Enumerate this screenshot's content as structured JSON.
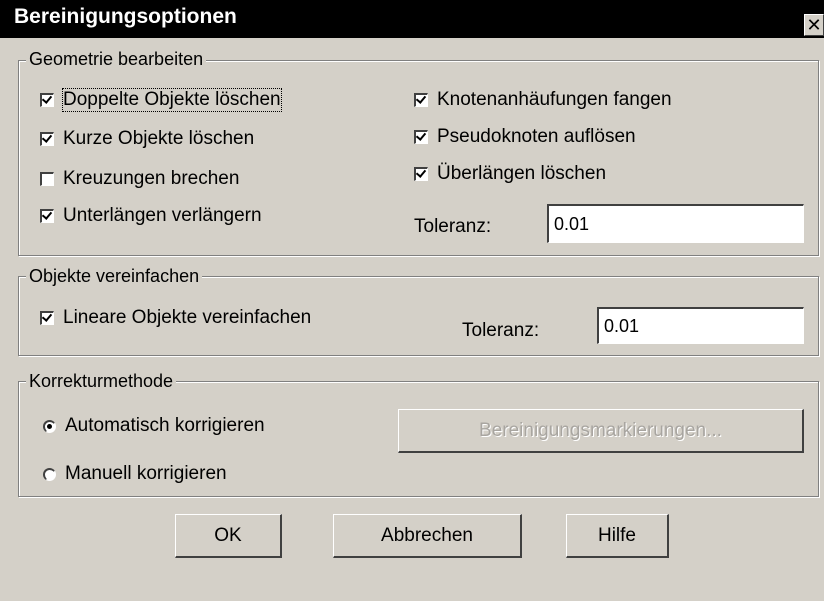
{
  "title": "Bereinigungsoptionen",
  "close_glyph": "✕",
  "geometry": {
    "legend": "Geometrie bearbeiten",
    "left_options": [
      {
        "label": "Doppelte Objekte löschen",
        "checked": true
      },
      {
        "label": "Kurze Objekte löschen",
        "checked": true
      },
      {
        "label": "Kreuzungen brechen",
        "checked": false
      },
      {
        "label": "Unterlängen verlängern",
        "checked": true
      }
    ],
    "right_options": [
      {
        "label": "Knotenanhäufungen fangen",
        "checked": true
      },
      {
        "label": "Pseudoknoten auflösen",
        "checked": true
      },
      {
        "label": "Überlängen löschen",
        "checked": true
      }
    ],
    "tolerance_label": "Toleranz:",
    "tolerance_value": "0.01"
  },
  "simplify": {
    "legend": "Objekte vereinfachen",
    "option": {
      "label": "Lineare Objekte vereinfachen",
      "checked": true
    },
    "tolerance_label": "Toleranz:",
    "tolerance_value": "0.01"
  },
  "correction": {
    "legend": "Korrekturmethode",
    "options": [
      {
        "label": "Automatisch korrigieren",
        "selected": true
      },
      {
        "label": "Manuell korrigieren",
        "selected": false
      }
    ],
    "markers_button": "Bereinigungsmarkierungen..."
  },
  "buttons": {
    "ok": "OK",
    "cancel": "Abbrechen",
    "help": "Hilfe"
  }
}
